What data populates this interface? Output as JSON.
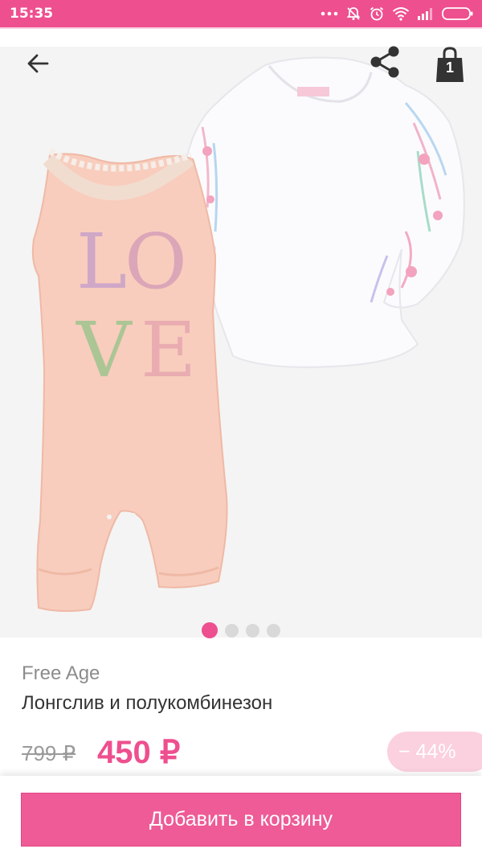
{
  "status_bar": {
    "time": "15:35",
    "icons": [
      "more-dots-icon",
      "muted-bell-icon",
      "alarm-icon",
      "wifi-icon",
      "signal-icon",
      "battery-icon"
    ]
  },
  "header": {
    "back_icon": "arrow-left-icon",
    "share_icon": "share-icon",
    "cart_icon": "shopping-bag-icon",
    "cart_count": "1"
  },
  "gallery": {
    "image": "baby-romper-and-longsleeve-photo",
    "romper_print": "LOVE",
    "slide_count": 4,
    "active_slide": 1
  },
  "product": {
    "brand": "Free Age",
    "name": "Лонгслив и полукомбинезон",
    "old_price": "799 ₽",
    "new_price": "450 ₽",
    "discount": "− 44%"
  },
  "actions": {
    "add_to_cart": "Добавить в корзину"
  },
  "colors": {
    "accent": "#ee4f8f",
    "button": "#ee5b97",
    "badge": "#fbd0df"
  }
}
